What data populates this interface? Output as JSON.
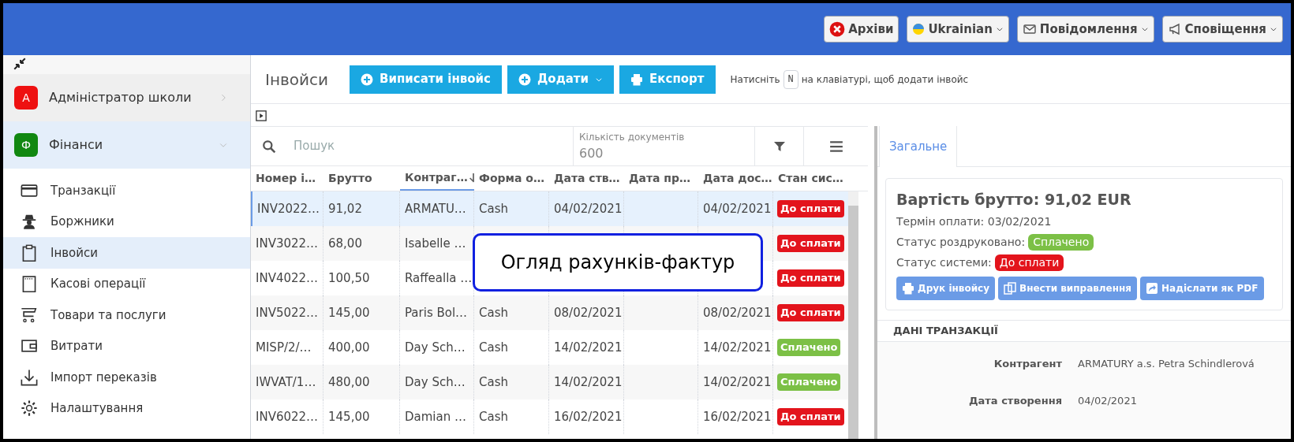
{
  "topbar": {
    "buttons": [
      {
        "kind": "archive",
        "label": "Архіви",
        "dropdown": false
      },
      {
        "kind": "language",
        "label": "Ukrainian",
        "dropdown": true
      },
      {
        "kind": "messages",
        "label": "Повідомлення",
        "dropdown": true
      },
      {
        "kind": "notifications",
        "label": "Сповіщення",
        "dropdown": true
      }
    ]
  },
  "sidebar": {
    "sections": [
      {
        "letter": "A",
        "label": "Адміністратор школи",
        "color": "#ee1111",
        "expanded": false
      },
      {
        "letter": "Ф",
        "label": "Фінанси",
        "color": "#118811",
        "expanded": true
      }
    ],
    "items": [
      {
        "kind": "card",
        "label": "Транзакції",
        "selected": false
      },
      {
        "kind": "spy",
        "label": "Боржники",
        "selected": false
      },
      {
        "kind": "clipboard",
        "label": "Інвойси",
        "selected": true
      },
      {
        "kind": "register",
        "label": "Касові операції",
        "selected": false
      },
      {
        "kind": "cart",
        "label": "Товари та послуги",
        "selected": false
      },
      {
        "kind": "wallet",
        "label": "Витрати",
        "selected": false
      },
      {
        "kind": "import",
        "label": "Імпорт переказів",
        "selected": false
      },
      {
        "kind": "gear",
        "label": "Налаштування",
        "selected": false
      }
    ]
  },
  "header": {
    "title": "Інвойси",
    "buttons": [
      {
        "kind": "plus",
        "label": "Виписати інвойс",
        "dropdown": false
      },
      {
        "kind": "plus",
        "label": "Додати",
        "dropdown": true
      },
      {
        "kind": "print",
        "label": "Експорт",
        "dropdown": false
      }
    ],
    "hint_before": "Натисніть",
    "hint_key": "N",
    "hint_after": "на клавіатурі, щоб додати інвойс"
  },
  "table": {
    "search": {
      "placeholder": "Пошук"
    },
    "count_label": "Кількість документів",
    "count": "600",
    "columns": [
      {
        "label": "Номер і…",
        "sorted": false
      },
      {
        "label": "Брутто",
        "sorted": false
      },
      {
        "label": "Контраг…",
        "sorted": true
      },
      {
        "label": "Форма о…",
        "sorted": false
      },
      {
        "label": "Дата ств…",
        "sorted": false
      },
      {
        "label": "Дата пр…",
        "sorted": false
      },
      {
        "label": "Дата дос…",
        "sorted": false
      },
      {
        "label": "Стан сис…",
        "sorted": false
      }
    ],
    "rows": [
      {
        "selected": true,
        "cells": [
          "INV2022…",
          "91,02",
          "ARMATU…",
          "Cash",
          "04/02/2021",
          "",
          "04/02/2021"
        ],
        "status": {
          "label": "До сплати",
          "kind": "due"
        }
      },
      {
        "selected": false,
        "cells": [
          "INV3022…",
          "68,00",
          "Isabelle …",
          "",
          "",
          "",
          ""
        ],
        "status": {
          "label": "До сплати",
          "kind": "due"
        }
      },
      {
        "selected": false,
        "cells": [
          "INV4022…",
          "100,50",
          "Raffealla …",
          "",
          "",
          "",
          ""
        ],
        "status": {
          "label": "До сплати",
          "kind": "due"
        }
      },
      {
        "selected": false,
        "cells": [
          "INV5022…",
          "145,00",
          "Paris Bol…",
          "Cash",
          "08/02/2021",
          "",
          "08/02/2021"
        ],
        "status": {
          "label": "До сплати",
          "kind": "due"
        }
      },
      {
        "selected": false,
        "cells": [
          "MISP/2/…",
          "400,00",
          "Day Sch…",
          "Cash",
          "14/02/2021",
          "",
          "14/02/2021"
        ],
        "status": {
          "label": "Сплачено",
          "kind": "paid"
        }
      },
      {
        "selected": false,
        "cells": [
          "IWVAT/1…",
          "480,00",
          "Day Sch…",
          "Cash",
          "14/02/2021",
          "",
          "14/02/2021"
        ],
        "status": {
          "label": "Сплачено",
          "kind": "paid"
        }
      },
      {
        "selected": false,
        "cells": [
          "INV6022…",
          "145,00",
          "Damian …",
          "Cash",
          "16/02/2021",
          "",
          "16/02/2021"
        ],
        "status": {
          "label": "До сплати",
          "kind": "due"
        }
      }
    ]
  },
  "callout": "Огляд рахунків-фактур",
  "detail": {
    "tabs": [
      {
        "label": "Загальне",
        "selected": true
      }
    ],
    "gross": "Вартість брутто: 91,02 EUR",
    "due": "Термін оплати: 03/02/2021",
    "statuses": [
      {
        "label": "Статус роздруковано:",
        "badge": "Сплачено",
        "kind": "paid"
      },
      {
        "label": "Статус системи:",
        "badge": "До сплати",
        "kind": "due"
      }
    ],
    "actions": [
      {
        "kind": "print",
        "label": "Друк інвойсу"
      },
      {
        "kind": "copy",
        "label": "Внести виправлення"
      },
      {
        "kind": "share",
        "label": "Надіслати як PDF"
      }
    ],
    "section": "ДАНІ ТРАНЗАКЦІЇ",
    "fields": [
      {
        "label": "Контрагент",
        "value": "ARMATURY a.s. Petra Schindlerová"
      },
      {
        "label": "Дата створення",
        "value": "04/02/2021"
      }
    ]
  }
}
